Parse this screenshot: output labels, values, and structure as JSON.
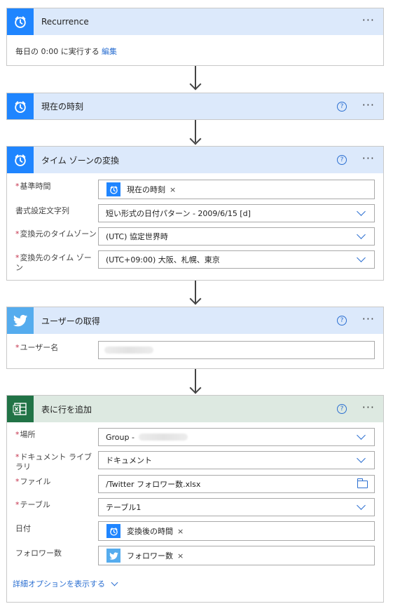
{
  "cards": {
    "recurrence": {
      "title": "Recurrence",
      "body_text": "毎日の 0:00 に実行する",
      "edit_link": "編集"
    },
    "current_time": {
      "title": "現在の時刻"
    },
    "timezone": {
      "title": "タイム ゾーンの変換",
      "fields": [
        {
          "label": "基準時間",
          "required": true,
          "token": "現在の時刻"
        },
        {
          "label": "書式設定文字列",
          "required": false,
          "value": "短い形式の日付パターン - 2009/6/15 [d]"
        },
        {
          "label": "変換元のタイムゾーン",
          "required": true,
          "value": "(UTC) 協定世界時"
        },
        {
          "label": "変換先のタイム ゾーン",
          "required": true,
          "value": "(UTC+09:00) 大阪、札幌、東京"
        }
      ]
    },
    "get_user": {
      "title": "ユーザーの取得",
      "fields": [
        {
          "label": "ユーザー名",
          "required": true,
          "value": ""
        }
      ]
    },
    "add_row": {
      "title": "表に行を追加",
      "fields": [
        {
          "label": "場所",
          "required": true,
          "value": "Group -"
        },
        {
          "label": "ドキュメント ライブラリ",
          "required": true,
          "value": "ドキュメント"
        },
        {
          "label": "ファイル",
          "required": true,
          "value": "/Twitter フォロワー数.xlsx"
        },
        {
          "label": "テーブル",
          "required": true,
          "value": "テーブル1"
        },
        {
          "label": "日付",
          "required": false,
          "token": "変換後の時間"
        },
        {
          "label": "フォロワー数",
          "required": false,
          "token": "フォロワー数"
        }
      ],
      "advanced_link": "詳細オプションを表示する"
    }
  },
  "ui": {
    "more_glyph": "···",
    "help_glyph": "?",
    "required_mark": "*",
    "token_close": "×"
  },
  "colors": {
    "accent": "#2b6fd1",
    "schedule_icon_bg": "#1f85ff",
    "twitter_icon_bg": "#55acee",
    "excel_icon_bg": "#217346",
    "card_header_bg": "#dce9fb",
    "excel_header_bg": "#dde9e1",
    "required": "#c4314b"
  }
}
